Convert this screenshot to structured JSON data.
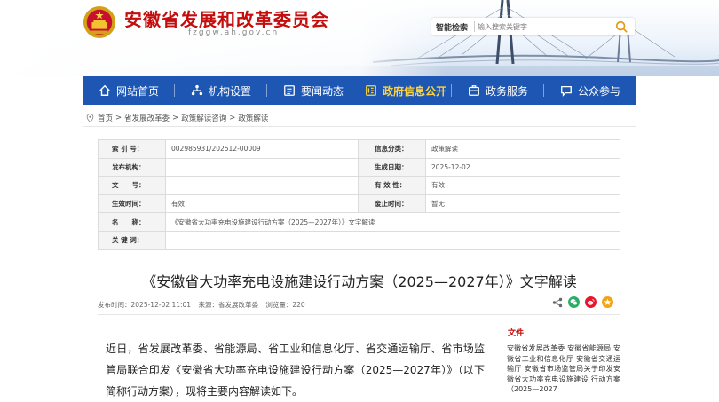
{
  "header": {
    "site_title": "安徽省发展和改革委员会",
    "site_domain": "fzggw.ah.gov.cn",
    "search": {
      "label": "智能检索",
      "placeholder": "输入搜索关键字"
    }
  },
  "nav": {
    "items": [
      {
        "label": "网站首页",
        "icon": "home-icon"
      },
      {
        "label": "机构设置",
        "icon": "org-icon"
      },
      {
        "label": "要闻动态",
        "icon": "news-icon"
      },
      {
        "label": "政府信息公开",
        "icon": "gov-info-icon",
        "active": true
      },
      {
        "label": "政务服务",
        "icon": "service-icon"
      },
      {
        "label": "公众参与",
        "icon": "public-icon"
      }
    ]
  },
  "breadcrumb": [
    "首页",
    "省发展改革委",
    "政策解读咨询",
    "政策解读"
  ],
  "info": {
    "index_no": {
      "label": "索 引 号：",
      "value": "002985931/202512-00009"
    },
    "category": {
      "label": "信息分类：",
      "value": "政策解读"
    },
    "publisher": {
      "label": "发布机构：",
      "value": ""
    },
    "created": {
      "label": "生成日期：",
      "value": "2025-12-02"
    },
    "doc_no": {
      "label": "文　　号：",
      "value": ""
    },
    "validity": {
      "label": "有 效 性：",
      "value": "有效"
    },
    "effective": {
      "label": "生效时间：",
      "value": "有效"
    },
    "expire": {
      "label": "废止时间：",
      "value": "暂无"
    },
    "name": {
      "label": "名　　称：",
      "value": "《安徽省大功率充电设施建设行动方案（2025—2027年）》文字解读"
    },
    "keywords": {
      "label": "关 键 词：",
      "value": ""
    }
  },
  "article": {
    "title": "《安徽省大功率充电设施建设行动方案（2025—2027年）》文字解读",
    "publish_time": "发布时间：2025-12-02 11:01",
    "source": "来源：省发展改革委",
    "views": "浏览量：220",
    "body": "近日，省发展改革委、省能源局、省工业和信息化厅、省交通运输厅、省市场监管局联合印发《安徽省大功率充电设施建设行动方案（2025—2027年）》（以下简称行动方案），现将主要内容解读如下。"
  },
  "sidebar": {
    "title": "文件",
    "text": "安徽省发展改革委 安徽省能源局 安徽省工业和信息化厅 安徽省交通运输厅 安徽省市场监管局关于印发安徽省大功率充电设施建设 行动方案（2025—2027"
  },
  "colors": {
    "brand_red": "#c40d0d",
    "nav_blue": "#1d57b3",
    "nav_active": "#ffd33d",
    "wechat_green": "#2aae67",
    "weibo_red": "#e6162d",
    "qzone_orange": "#f2a31a"
  }
}
